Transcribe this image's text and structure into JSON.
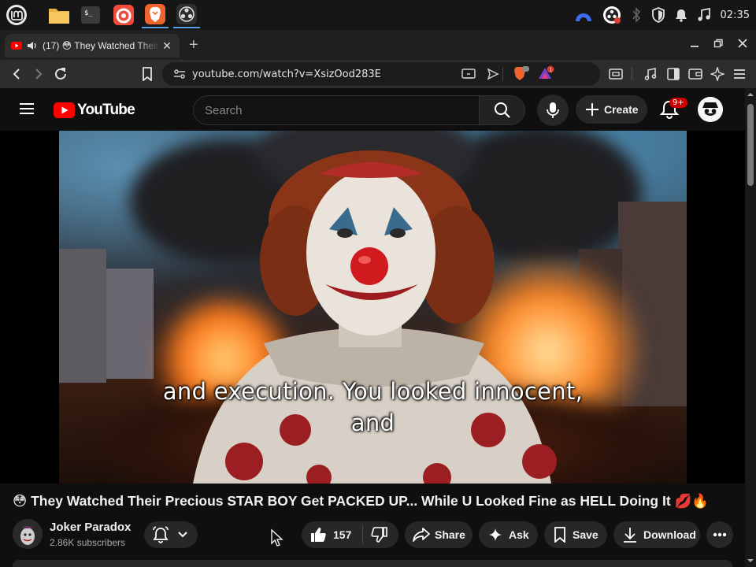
{
  "taskbar": {
    "apps": [
      {
        "name": "Linux Mint menu",
        "icon": "mint-logo-icon"
      },
      {
        "name": "Files",
        "icon": "folder-icon"
      },
      {
        "name": "Terminal",
        "icon": "terminal-icon"
      },
      {
        "name": "Firefox",
        "icon": "firefox-icon"
      },
      {
        "name": "Brave",
        "icon": "brave-icon"
      },
      {
        "name": "OBS Studio",
        "icon": "obs-icon"
      }
    ],
    "clock": "02:35",
    "tray_icons": [
      "vpn-icon",
      "obs-tray-icon",
      "bluetooth-icon",
      "shield-icon",
      "notifications-icon",
      "media-icon"
    ]
  },
  "browser": {
    "tab": {
      "title": "(17) 😳 They Watched Their Precious STAR BOY Get PACKED UP... While U Looked Fine as HELL Doing It 💋🔥 - YouTube",
      "audio_icon": "speaker-icon"
    },
    "url": "youtube.com/watch?v=XsizOod283E",
    "brave_badge": "",
    "extension_badge": "1"
  },
  "youtube": {
    "logo_text": "YouTube",
    "search_placeholder": "Search",
    "create_label": "Create",
    "notification_count": "9+",
    "subtitle_line1": "and execution. You looked innocent,",
    "subtitle_line2": "and",
    "video_title": "😳 They Watched Their Precious STAR BOY Get PACKED UP... While U Looked Fine as HELL Doing It 💋🔥",
    "channel": {
      "name": "Joker Paradox",
      "subscribers": "2.86K subscribers",
      "avatar_text": "JOKER PARADOX"
    },
    "actions": {
      "likes": "157",
      "share": "Share",
      "ask": "Ask",
      "save": "Save",
      "download": "Download"
    }
  },
  "colors": {
    "youtube_red": "#ff0000",
    "background": "#0f0f0f",
    "pill_bg": "#272727",
    "badge_red": "#cc0000"
  }
}
